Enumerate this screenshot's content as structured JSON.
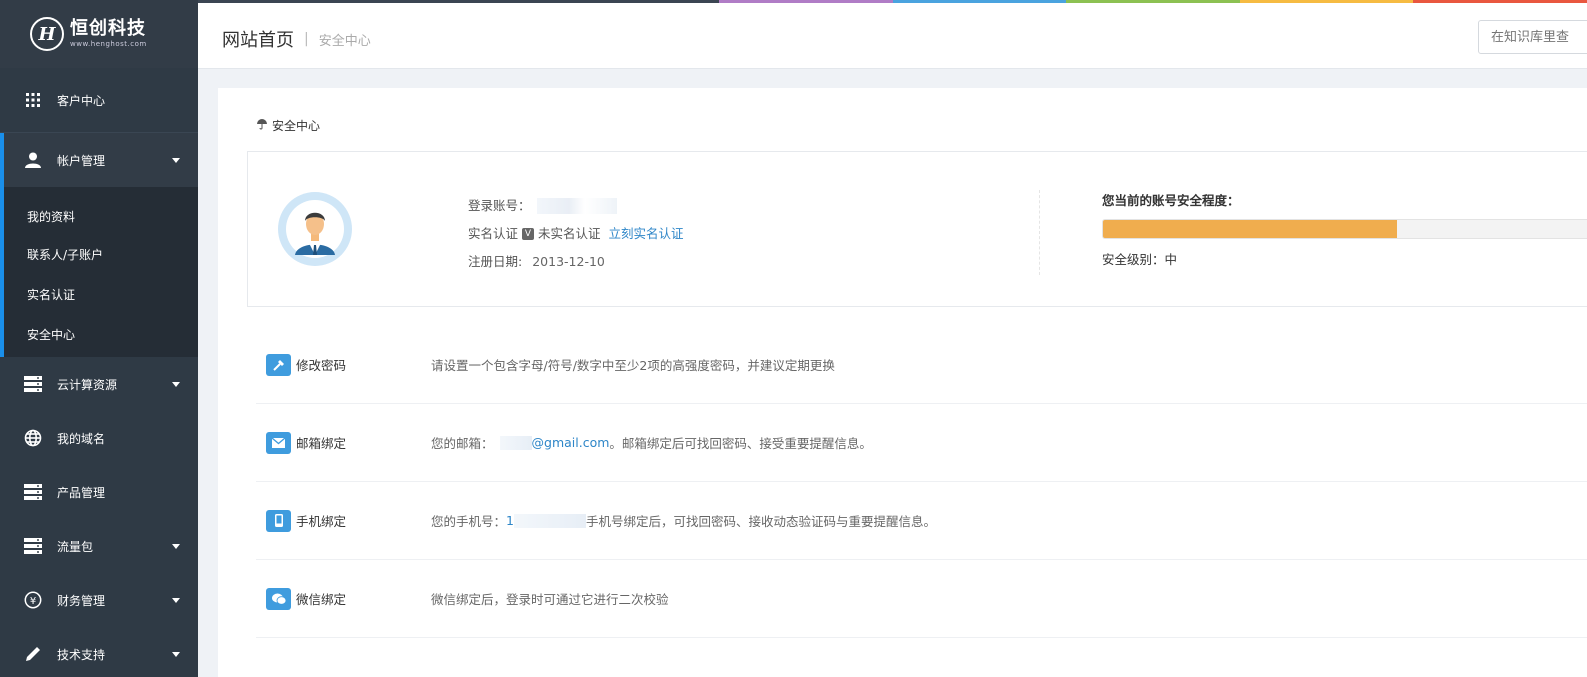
{
  "brand": {
    "cn": "恒创科技",
    "en": "www.henghost.com",
    "glyph": "H"
  },
  "colors": {
    "sidebar": "#2f3a45",
    "accent": "#1a8fea",
    "progress": "#f0ad4e",
    "link": "#2e86c8"
  },
  "sidebar": {
    "items": [
      {
        "label": "客户中心",
        "icon": "grid-icon"
      },
      {
        "label": "帐户管理",
        "icon": "user-icon",
        "expanded": true,
        "children": [
          "我的资料",
          "联系人/子账户",
          "实名认证",
          "安全中心"
        ]
      },
      {
        "label": "云计算资源",
        "icon": "server-icon",
        "has_caret": true
      },
      {
        "label": "我的域名",
        "icon": "globe-icon"
      },
      {
        "label": "产品管理",
        "icon": "server-icon"
      },
      {
        "label": "流量包",
        "icon": "server-icon",
        "has_caret": true
      },
      {
        "label": "财务管理",
        "icon": "yuan-icon",
        "has_caret": true
      },
      {
        "label": "技术支持",
        "icon": "pencil-icon",
        "has_caret": true
      }
    ]
  },
  "header": {
    "breadcrumb_main": "网站首页",
    "breadcrumb_sep": "|",
    "breadcrumb_sub": "安全中心",
    "search_placeholder": "在知识库里查"
  },
  "section_title": "安全中心",
  "profile": {
    "account_label": "登录账号：",
    "realname_label": "实名认证",
    "realname_status": "未实名认证",
    "realname_link": "立刻实名认证",
    "reg_label": "注册日期:",
    "reg_date": "2013-12-10"
  },
  "security": {
    "label": "您当前的账号安全程度：",
    "level_text": "安全级别：中",
    "progress": 0.59
  },
  "settings": [
    {
      "name": "修改密码",
      "icon": "wrench-icon",
      "desc": "请设置一个包含字母/符号/数字中至少2项的高强度密码，并建议定期更换"
    },
    {
      "name": "邮箱绑定",
      "icon": "mail-icon",
      "desc_prefix": "您的邮箱：",
      "desc_value": "@gmail.com",
      "desc_suffix": "。邮箱绑定后可找回密码、接受重要提醒信息。"
    },
    {
      "name": "手机绑定",
      "icon": "phone-icon",
      "desc_prefix": "您的手机号：",
      "desc_value": "1",
      "desc_suffix": "手机号绑定后，可找回密码、接收动态验证码与重要提醒信息。"
    },
    {
      "name": "微信绑定",
      "icon": "wechat-icon",
      "desc": "微信绑定后，登录时可通过它进行二次校验"
    }
  ]
}
